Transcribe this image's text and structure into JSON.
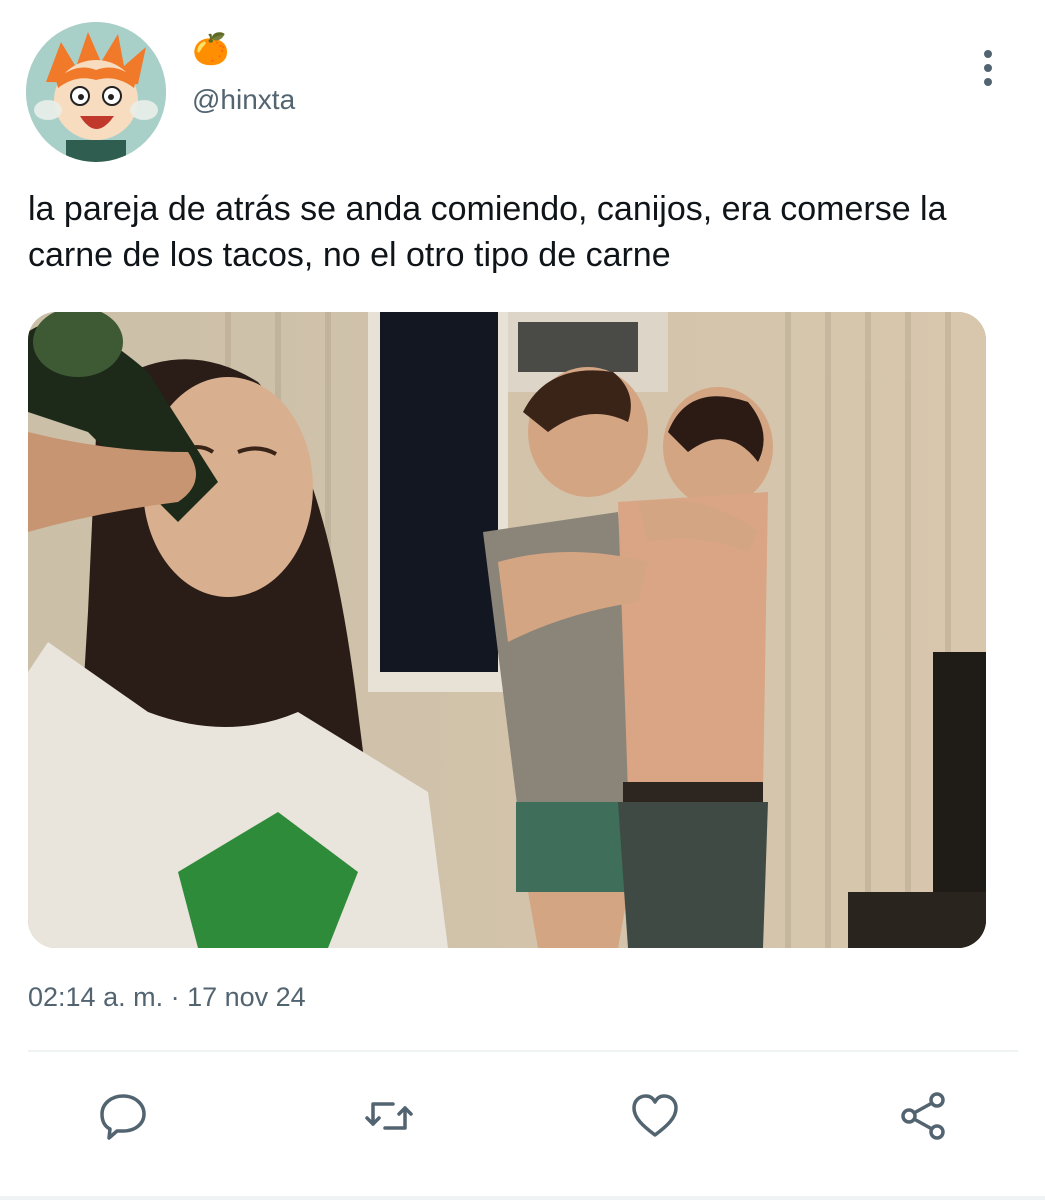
{
  "tweet": {
    "display_name": "🍊",
    "handle": "@hinxta",
    "text": "la pareja de atrás se anda comiendo, canijos, era comerse la carne de los tacos, no el otro tipo de carne",
    "timestamp": "02:14 a. m. · 17 nov 24",
    "avatar_icon": "anime-character-avatar",
    "media_description_icon": "photo-party-image"
  },
  "actions": [
    {
      "name": "reply-icon"
    },
    {
      "name": "retweet-icon"
    },
    {
      "name": "like-icon"
    },
    {
      "name": "share-icon"
    }
  ],
  "colors": {
    "text": "#0f1419",
    "secondary": "#536471",
    "divider": "#eff3f4"
  }
}
